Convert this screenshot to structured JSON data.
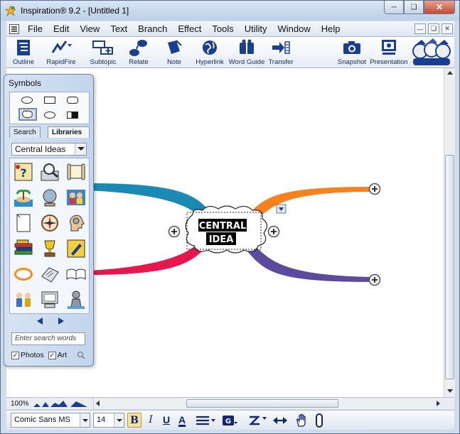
{
  "window": {
    "title": "Inspiration® 9.2 - [Untitled 1]"
  },
  "menu": [
    "File",
    "Edit",
    "View",
    "Text",
    "Branch",
    "Effect",
    "Tools",
    "Utility",
    "Window",
    "Help"
  ],
  "toolbar": {
    "outline": "Outline",
    "rapidfire": "RapidFire",
    "subtopic": "Subtopic",
    "relate": "Relate",
    "note": "Note",
    "hyperlink": "Hyperlink",
    "wordguide": "Word Guide",
    "transfer": "Transfer",
    "snapshot": "Snapshot",
    "presentation": "Presentation"
  },
  "symbols": {
    "title": "Symbols",
    "tab_search": "Search",
    "tab_libraries": "Libraries",
    "category": "Central Ideas",
    "search_placeholder": "Enter search words",
    "photos_label": "Photos",
    "art_label": "Art"
  },
  "diagram": {
    "central_idea": "CENTRAL\nIDEA",
    "branch_colors": {
      "top_left": "#1a8ab5",
      "bottom_left": "#e8164f",
      "top_right": "#f5821f",
      "bottom_right": "#5b4a9e"
    }
  },
  "status": {
    "zoom": "100%"
  },
  "format": {
    "font": "Comic Sans MS",
    "size": "14"
  }
}
